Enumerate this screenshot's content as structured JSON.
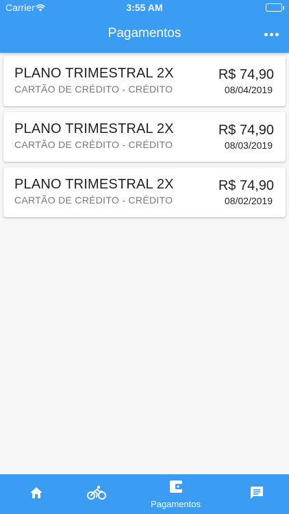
{
  "status_bar": {
    "carrier": "Carrier",
    "time": "3:55 AM"
  },
  "appbar": {
    "title": "Pagamentos",
    "menu_icon": "more-horizontal-icon"
  },
  "payments": [
    {
      "plan": "PLANO TRIMESTRAL 2X",
      "method": "CARTÃO DE CRÉDITO - CRÉDITO",
      "amount": "R$ 74,90",
      "date": "08/04/2019"
    },
    {
      "plan": "PLANO TRIMESTRAL 2X",
      "method": "CARTÃO DE CRÉDITO - CRÉDITO",
      "amount": "R$ 74,90",
      "date": "08/03/2019"
    },
    {
      "plan": "PLANO TRIMESTRAL 2X",
      "method": "CARTÃO DE CRÉDITO - CRÉDITO",
      "amount": "R$ 74,90",
      "date": "08/02/2019"
    }
  ],
  "bottom_nav": {
    "items": [
      {
        "icon": "home-icon",
        "label": ""
      },
      {
        "icon": "bike-icon",
        "label": ""
      },
      {
        "icon": "wallet-icon",
        "label": "Pagamentos",
        "active": true
      },
      {
        "icon": "chat-icon",
        "label": ""
      }
    ]
  },
  "colors": {
    "primary": "#3a9cf3",
    "background": "#f7f7f7",
    "card": "#ffffff",
    "text_primary": "#222222",
    "text_secondary": "#777777"
  }
}
